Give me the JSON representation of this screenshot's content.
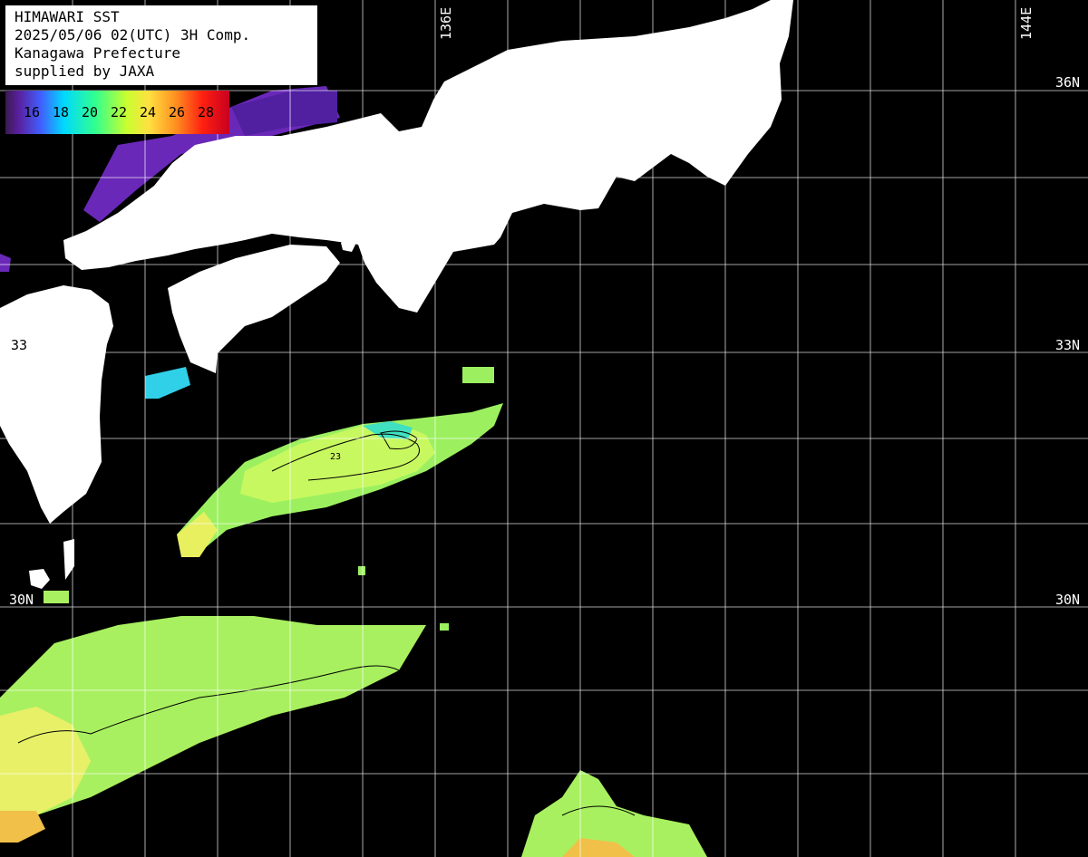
{
  "header": {
    "line1": "HIMAWARI SST",
    "line2": "2025/05/06 02(UTC) 3H Comp.",
    "line3": "Kanagawa Prefecture",
    "line4": "supplied by JAXA"
  },
  "legend": {
    "labels": [
      "16",
      "18",
      "20",
      "22",
      "24",
      "26",
      "28"
    ]
  },
  "grid_labels": {
    "lon_136": "136E",
    "lon_144": "144E",
    "lat_36": "36N",
    "lat_33": "33N",
    "lat_30": "30N",
    "lat_33_left": "33",
    "lat_30_left": "30N"
  },
  "contour_labels": {
    "c23": "23"
  },
  "colors": {
    "land": "#ffffff",
    "ocean_no_data": "#000000",
    "grid": "#ffffff"
  }
}
